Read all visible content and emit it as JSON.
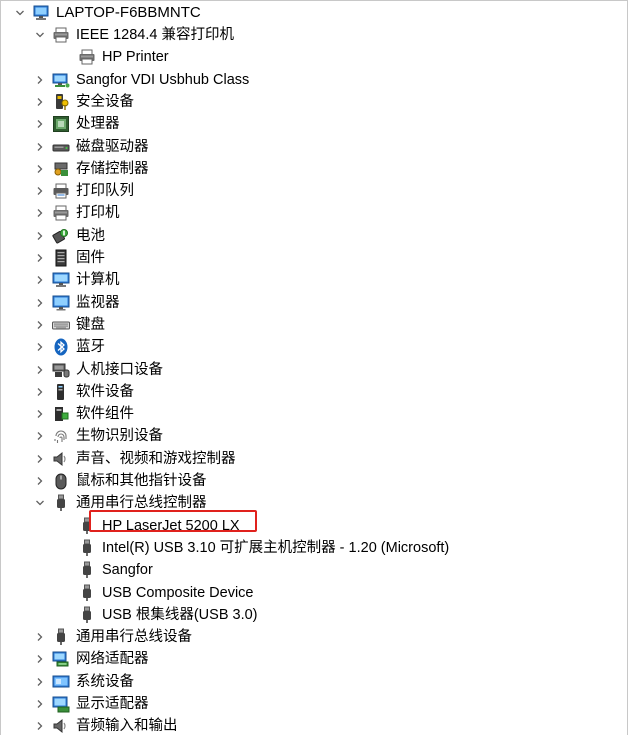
{
  "tree": {
    "root": {
      "label": "LAPTOP-F6BBMNTC",
      "icon": "computer-icon"
    },
    "items": [
      {
        "label": "IEEE 1284.4 兼容打印机",
        "icon": "printer-icon",
        "level": 1,
        "expanded": true
      },
      {
        "label": "HP Printer",
        "icon": "printer-icon",
        "level": 2
      },
      {
        "label": "Sangfor VDI Usbhub Class",
        "icon": "monitor-network-icon",
        "level": 1
      },
      {
        "label": "安全设备",
        "icon": "security-key-icon",
        "level": 1
      },
      {
        "label": "处理器",
        "icon": "processor-icon",
        "level": 1
      },
      {
        "label": "磁盘驱动器",
        "icon": "disk-drive-icon",
        "level": 1
      },
      {
        "label": "存储控制器",
        "icon": "storage-controller-icon",
        "level": 1
      },
      {
        "label": "打印队列",
        "icon": "print-queue-icon",
        "level": 1
      },
      {
        "label": "打印机",
        "icon": "printer-icon",
        "level": 1
      },
      {
        "label": "电池",
        "icon": "battery-icon",
        "level": 1
      },
      {
        "label": "固件",
        "icon": "firmware-icon",
        "level": 1
      },
      {
        "label": "计算机",
        "icon": "computer-icon",
        "level": 1
      },
      {
        "label": "监视器",
        "icon": "monitor-icon",
        "level": 1
      },
      {
        "label": "键盘",
        "icon": "keyboard-icon",
        "level": 1
      },
      {
        "label": "蓝牙",
        "icon": "bluetooth-icon",
        "level": 1
      },
      {
        "label": "人机接口设备",
        "icon": "hid-icon",
        "level": 1
      },
      {
        "label": "软件设备",
        "icon": "software-device-icon",
        "level": 1
      },
      {
        "label": "软件组件",
        "icon": "software-component-icon",
        "level": 1
      },
      {
        "label": "生物识别设备",
        "icon": "fingerprint-icon",
        "level": 1
      },
      {
        "label": "声音、视频和游戏控制器",
        "icon": "speaker-icon",
        "level": 1
      },
      {
        "label": "鼠标和其他指针设备",
        "icon": "mouse-icon",
        "level": 1
      },
      {
        "label": "通用串行总线控制器",
        "icon": "usb-icon",
        "level": 1,
        "expanded": true
      },
      {
        "label": "HP LaserJet 5200 LX",
        "icon": "usb-icon",
        "level": 2,
        "highlighted": true
      },
      {
        "label": "Intel(R) USB 3.10 可扩展主机控制器 - 1.20 (Microsoft)",
        "icon": "usb-icon",
        "level": 2
      },
      {
        "label": "Sangfor",
        "icon": "usb-icon",
        "level": 2
      },
      {
        "label": "USB Composite Device",
        "icon": "usb-icon",
        "level": 2
      },
      {
        "label": "USB 根集线器(USB 3.0)",
        "icon": "usb-icon",
        "level": 2
      },
      {
        "label": "通用串行总线设备",
        "icon": "usb-icon",
        "level": 1
      },
      {
        "label": "网络适配器",
        "icon": "network-adapter-icon",
        "level": 1
      },
      {
        "label": "系统设备",
        "icon": "system-device-icon",
        "level": 1
      },
      {
        "label": "显示适配器",
        "icon": "display-adapter-icon",
        "level": 1
      },
      {
        "label": "音频输入和输出",
        "icon": "audio-io-icon",
        "level": 1
      }
    ]
  },
  "colors": {
    "highlight": "#e0211d",
    "chevron": "#606060"
  }
}
